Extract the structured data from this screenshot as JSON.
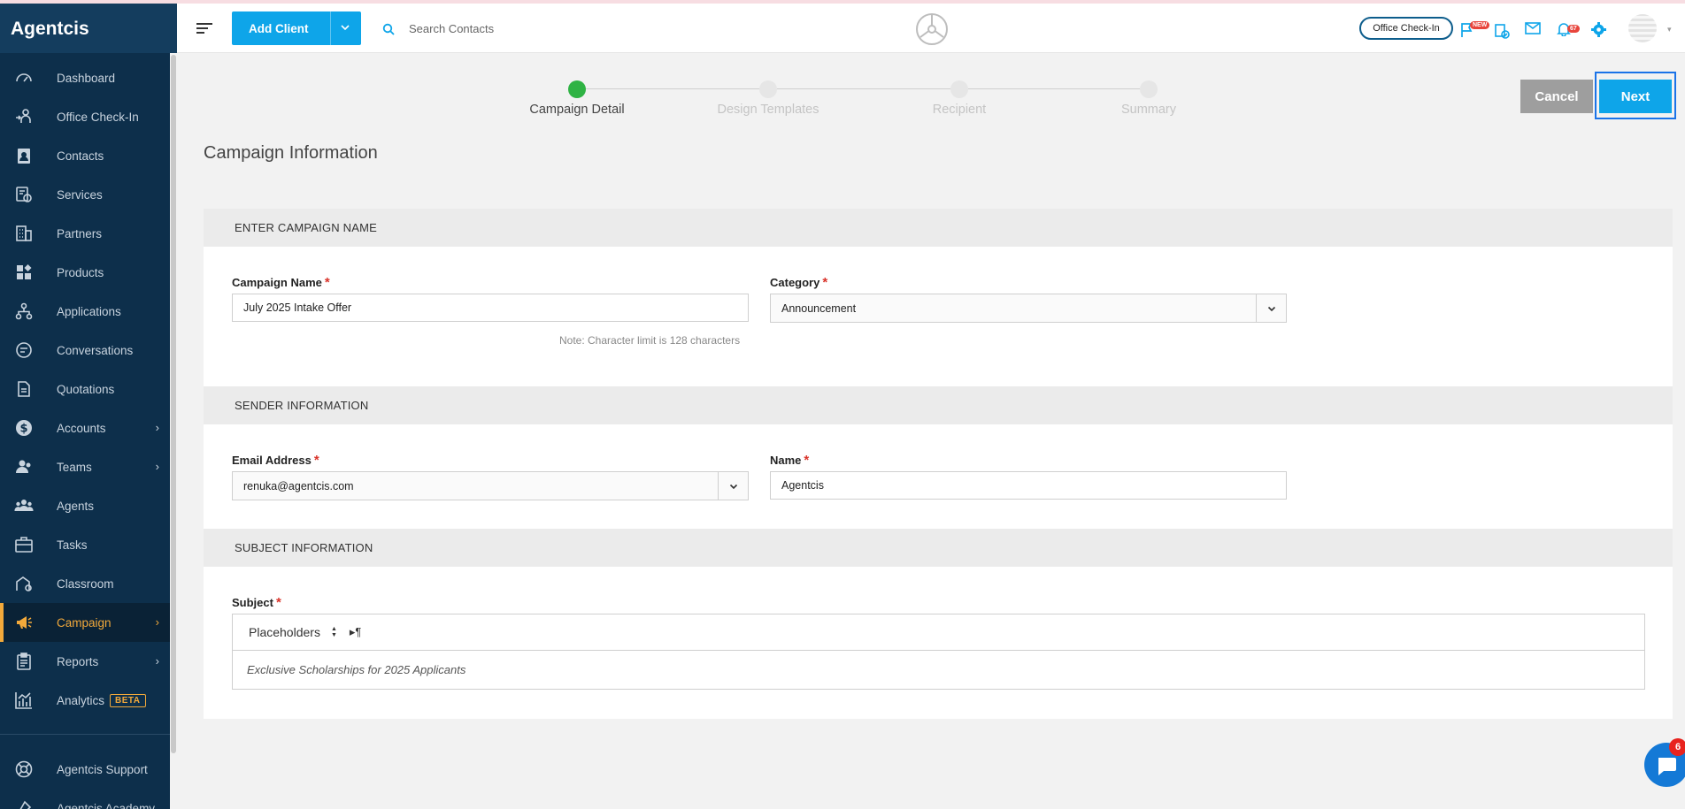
{
  "brand": "Agentcis",
  "sidebar": {
    "items": [
      {
        "label": "Dashboard",
        "icon": "gauge-icon",
        "chevron": false,
        "active": false
      },
      {
        "label": "Office Check-In",
        "icon": "checkin-icon",
        "chevron": false,
        "active": false
      },
      {
        "label": "Contacts",
        "icon": "contacts-icon",
        "chevron": false,
        "active": false
      },
      {
        "label": "Services",
        "icon": "services-icon",
        "chevron": false,
        "active": false
      },
      {
        "label": "Partners",
        "icon": "building-icon",
        "chevron": false,
        "active": false
      },
      {
        "label": "Products",
        "icon": "products-icon",
        "chevron": false,
        "active": false
      },
      {
        "label": "Applications",
        "icon": "flow-icon",
        "chevron": false,
        "active": false
      },
      {
        "label": "Conversations",
        "icon": "chat-bubble-icon",
        "chevron": false,
        "active": false
      },
      {
        "label": "Quotations",
        "icon": "document-icon",
        "chevron": false,
        "active": false
      },
      {
        "label": "Accounts",
        "icon": "dollar-icon",
        "chevron": true,
        "active": false
      },
      {
        "label": "Teams",
        "icon": "team-icon",
        "chevron": true,
        "active": false
      },
      {
        "label": "Agents",
        "icon": "agents-icon",
        "chevron": false,
        "active": false
      },
      {
        "label": "Tasks",
        "icon": "briefcase-icon",
        "chevron": false,
        "active": false
      },
      {
        "label": "Classroom",
        "icon": "classroom-icon",
        "chevron": false,
        "active": false
      },
      {
        "label": "Campaign",
        "icon": "megaphone-icon",
        "chevron": true,
        "active": true
      },
      {
        "label": "Reports",
        "icon": "clipboard-icon",
        "chevron": true,
        "active": false
      },
      {
        "label": "Analytics",
        "icon": "analytics-icon",
        "chevron": false,
        "active": false,
        "badge": "BETA"
      }
    ],
    "bottom": [
      {
        "label": "Agentcis Support",
        "icon": "lifebuoy-icon"
      },
      {
        "label": "Agentcis Academy",
        "icon": "academy-icon"
      }
    ]
  },
  "header": {
    "add_client": "Add Client",
    "search_placeholder": "Search Contacts",
    "office_checkin": "Office Check-In",
    "new_badge": "NEW",
    "notif_count": "67"
  },
  "stepper": {
    "steps": [
      "Campaign Detail",
      "Design Templates",
      "Recipient",
      "Summary"
    ],
    "active_index": 0
  },
  "actions": {
    "cancel": "Cancel",
    "next": "Next"
  },
  "page_title": "Campaign Information",
  "sections": {
    "campaign": {
      "heading": "ENTER CAMPAIGN NAME",
      "name_label": "Campaign Name",
      "name_value": "July 2025 Intake Offer",
      "name_note": "Note: Character limit is 128 characters",
      "category_label": "Category",
      "category_value": "Announcement"
    },
    "sender": {
      "heading": "SENDER INFORMATION",
      "email_label": "Email Address",
      "email_value": "renuka@agentcis.com",
      "name_label": "Name",
      "name_value": "Agentcis"
    },
    "subject": {
      "heading": "SUBJECT INFORMATION",
      "label": "Subject",
      "placeholders": "Placeholders",
      "ltr": "▸¶",
      "value": "Exclusive Scholarships for 2025 Applicants"
    }
  },
  "chat_badge": "6",
  "colors": {
    "sidebar": "#0d2f4b",
    "accent": "#0ea5e9",
    "active": "#f2a93b",
    "step_active": "#2fb344"
  }
}
